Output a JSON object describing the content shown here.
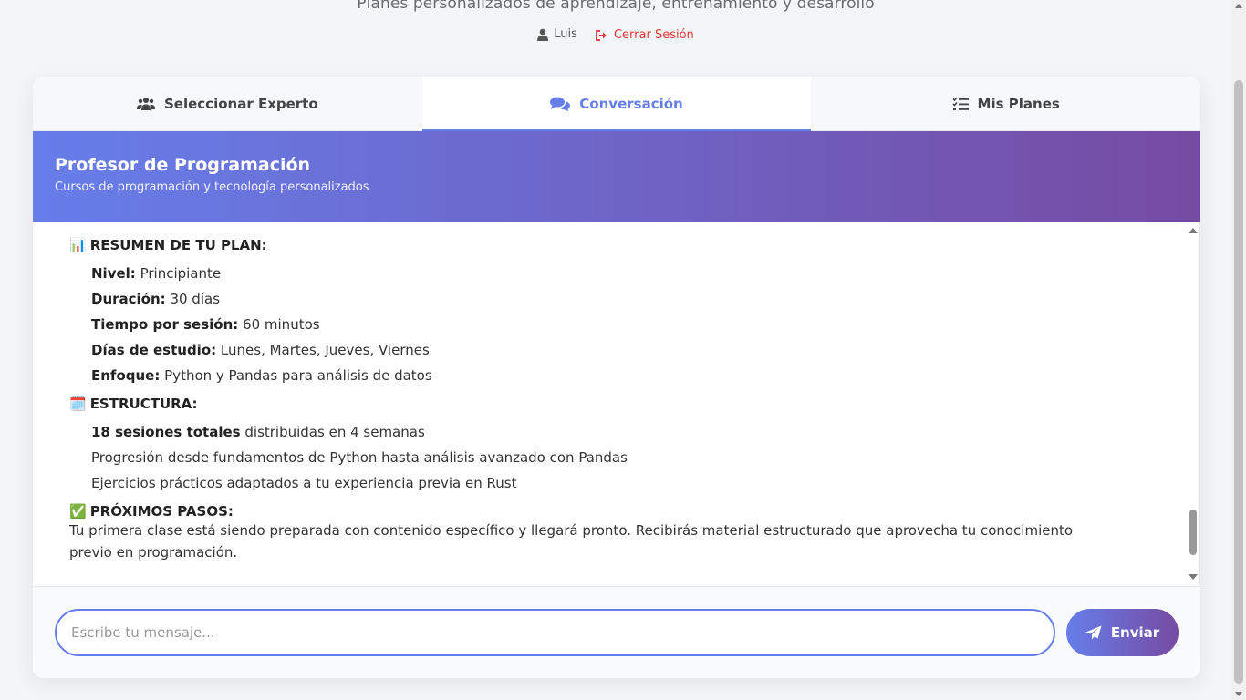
{
  "header": {
    "subtitle": "Planes personalizados de aprendizaje, entrenamiento y desarrollo",
    "user_name": "Luis",
    "logout_label": "Cerrar Sesión"
  },
  "tabs": [
    {
      "label": "Seleccionar Experto",
      "icon": "users-icon"
    },
    {
      "label": "Conversación",
      "icon": "comments-icon",
      "active": true
    },
    {
      "label": "Mis Planes",
      "icon": "checklist-icon"
    }
  ],
  "chat": {
    "title": "Profesor de Programación",
    "description": "Cursos de programación y tecnología personalizados"
  },
  "message": {
    "summary_heading": "RESUMEN DE TU PLAN:",
    "summary_icon": "📊",
    "summary_items": [
      {
        "label": "Nivel:",
        "value": "Principiante"
      },
      {
        "label": "Duración:",
        "value": "30 días"
      },
      {
        "label": "Tiempo por sesión:",
        "value": "60 minutos"
      },
      {
        "label": "Días de estudio:",
        "value": "Lunes, Martes, Jueves, Viernes"
      },
      {
        "label": "Enfoque:",
        "value": "Python y Pandas para análisis de datos"
      }
    ],
    "structure_heading": "ESTRUCTURA:",
    "structure_icon": "🗓️",
    "structure_items": [
      {
        "bold": "18 sesiones totales",
        "text": "distribuidas en 4 semanas"
      },
      {
        "bold": "",
        "text": "Progresión desde fundamentos de Python hasta análisis avanzado con Pandas"
      },
      {
        "bold": "",
        "text": "Ejercicios prácticos adaptados a tu experiencia previa en Rust"
      }
    ],
    "next_heading": "PRÓXIMOS PASOS:",
    "next_icon": "✅",
    "next_text": "Tu primera clase está siendo preparada con contenido específico y llegará pronto. Recibirás material estructurado que aprovecha tu conocimiento previo en programación."
  },
  "composer": {
    "placeholder": "Escribe tu mensaje...",
    "value": "",
    "send_label": "Enviar"
  },
  "colors": {
    "accent": "#667eea",
    "gradient_end": "#764ba2",
    "logout": "#e53935"
  }
}
